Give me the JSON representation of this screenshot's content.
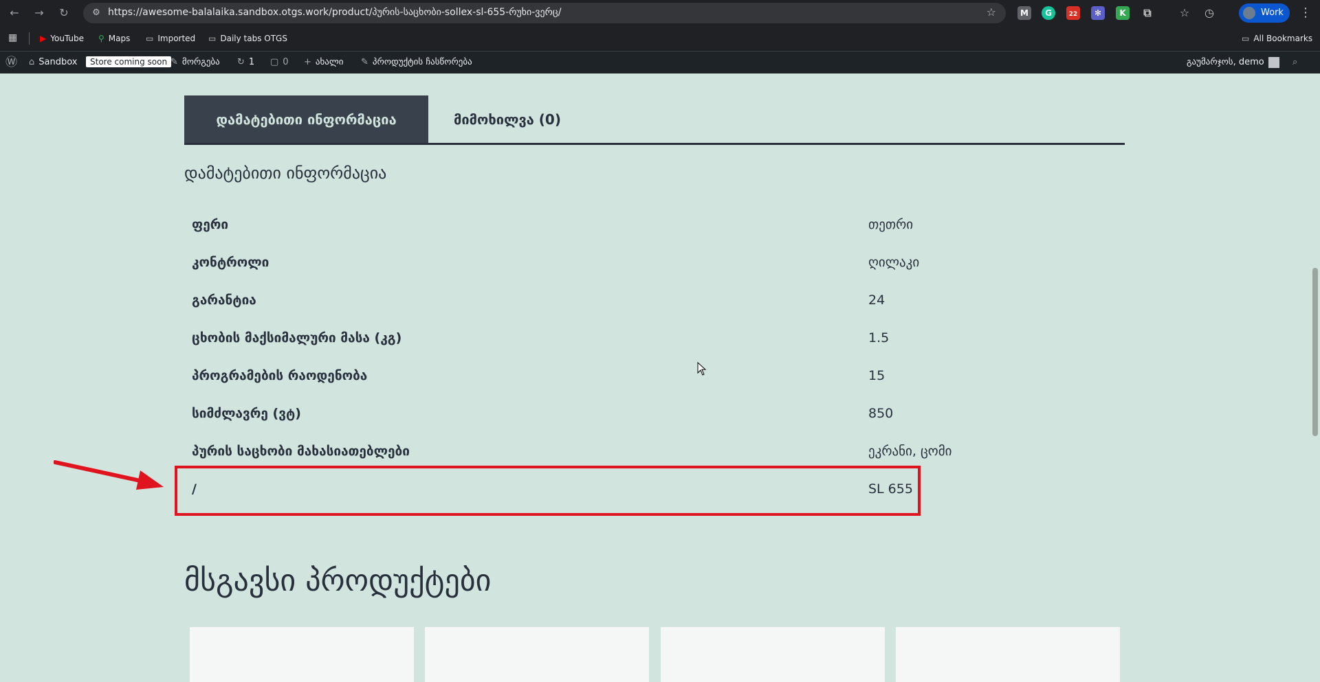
{
  "browser": {
    "url": "https://awesome-balalaika.sandbox.otgs.work/product/პურის-საცხობი-sollex-sl-655-რუხი-ვერც/",
    "bookmarks": [
      "YouTube",
      "Maps",
      "Imported",
      "Daily tabs OTGS"
    ],
    "all_bookmarks": "All Bookmarks",
    "profile_label": "Work",
    "ext_badge": "22"
  },
  "adminbar": {
    "site_name": "Sandbox",
    "coming_soon": "Store coming soon",
    "customize": "მორგება",
    "updates_count": "1",
    "comments_count": "0",
    "new": "ახალი",
    "edit_product": "პროდუქტის ჩასწორება",
    "greeting": "გაუმარჯოს, demo"
  },
  "tabs": {
    "additional_info": "დამატებითი ინფორმაცია",
    "reviews": "მიმოხილვა (0)"
  },
  "section_title": "დამატებითი ინფორმაცია",
  "attributes": [
    {
      "label": "ფერი",
      "value": "თეთრი"
    },
    {
      "label": "კონტროლი",
      "value": "ღილაკი"
    },
    {
      "label": "გარანტია",
      "value": "24"
    },
    {
      "label": "ცხობის მაქსიმალური მასა (კგ)",
      "value": "1.5"
    },
    {
      "label": "პროგრამების რაოდენობა",
      "value": "15"
    },
    {
      "label": "სიმძლავრე (ვტ)",
      "value": "850"
    },
    {
      "label": "პურის საცხობი მახასიათებლები",
      "value": "ეკრანი, ცომი"
    },
    {
      "label": "/",
      "value": "SL 655"
    }
  ],
  "related_title": "მსგავსი პროდუქტები",
  "colors": {
    "page_bg": "#d1e4dd",
    "text": "#28303d",
    "highlight": "#e0141e"
  }
}
